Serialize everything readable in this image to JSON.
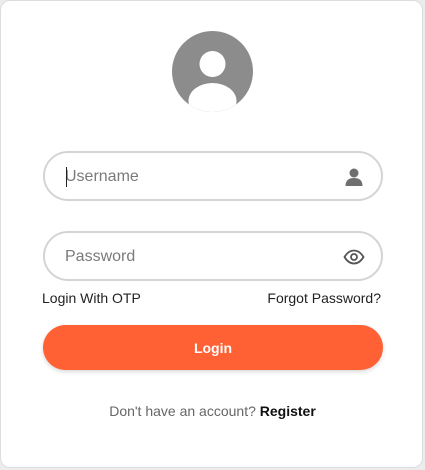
{
  "avatar": {
    "icon": "user-avatar-icon"
  },
  "form": {
    "username": {
      "placeholder": "Username",
      "value": "",
      "icon": "user-icon"
    },
    "password": {
      "placeholder": "Password",
      "value": "",
      "icon": "eye-icon"
    },
    "login_with_otp": "Login With OTP",
    "forgot_password": "Forgot Password?",
    "login_button": "Login",
    "register_prompt": "Don't have an account?",
    "register_link": "Register"
  },
  "colors": {
    "accent": "#ff6134",
    "avatar_bg": "#8c8c8c",
    "field_border": "#d4d4d4"
  }
}
